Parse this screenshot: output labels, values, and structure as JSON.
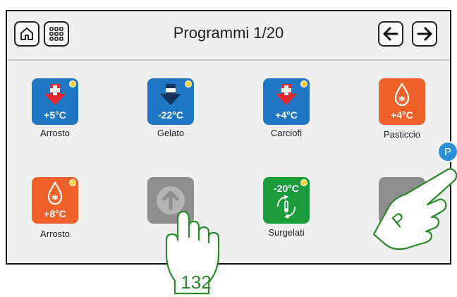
{
  "header": {
    "title": "Programmi 1/20"
  },
  "programs": [
    {
      "label": "Arrosto",
      "temp": "+5°C",
      "color": "#1f76c2",
      "icon": "red-down-arrow-plus-icon"
    },
    {
      "label": "Gelato",
      "temp": "-22°C",
      "color": "#1f76c2",
      "icon": "blue-down-arrow-minus-icon"
    },
    {
      "label": "Carciofi",
      "temp": "+4°C",
      "color": "#1f76c2",
      "icon": "red-down-arrow-plus-icon"
    },
    {
      "label": "Pasticcio",
      "temp": "+4°C",
      "color": "#f0612a",
      "icon": "droplet-icon"
    },
    {
      "label": "Arrosto",
      "temp": "+8°C",
      "color": "#f0612a",
      "icon": "droplet-icon"
    },
    {
      "label": "",
      "temp": "",
      "color": "#8e8e8e",
      "icon": "upload-arrow-icon"
    },
    {
      "label": "Surgelati",
      "temp": "-20°C",
      "color": "#1b9b3a",
      "icon": "thermometer-cycle-icon"
    },
    {
      "label": "",
      "temp": "",
      "color": "#8e8e8e",
      "icon": "partially-hidden-icon"
    }
  ],
  "indicator": {
    "bubble_letter": "P",
    "hand_letter": "P",
    "step_count": "132"
  }
}
